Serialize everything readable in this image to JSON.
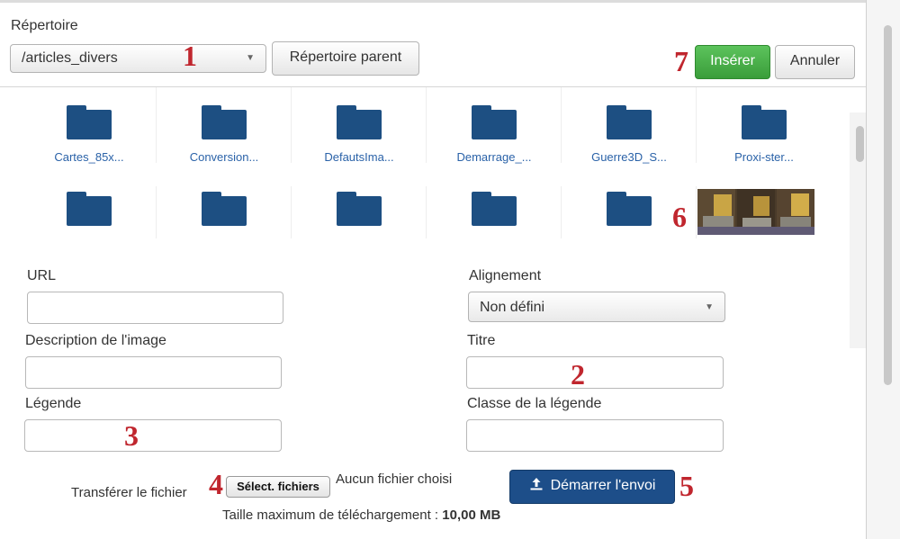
{
  "header": {
    "directory_label": "Répertoire",
    "directory_value": "/articles_divers",
    "parent_button": "Répertoire parent",
    "insert_button": "Insérer",
    "cancel_button": "Annuler"
  },
  "folders": [
    {
      "label": "Cartes_85x..."
    },
    {
      "label": "Conversion..."
    },
    {
      "label": "DefautsIma..."
    },
    {
      "label": "Demarrage_..."
    },
    {
      "label": "Guerre3D_S..."
    },
    {
      "label": "Proxi-ster..."
    }
  ],
  "form": {
    "url_label": "URL",
    "align_label": "Alignement",
    "align_value": "Non défini",
    "description_label": "Description de l'image",
    "title_label": "Titre",
    "caption_label": "Légende",
    "caption_class_label": "Classe de la légende"
  },
  "upload": {
    "transfer_label": "Transférer le fichier",
    "select_files_button": "Sélect. fichiers",
    "no_file_text": "Aucun fichier choisi",
    "start_upload_button": "Démarrer l'envoi",
    "max_size_label": "Taille maximum de téléchargement :",
    "max_size_value": "10,00 MB"
  },
  "annotations": [
    "1",
    "2",
    "3",
    "4",
    "5",
    "6",
    "7"
  ],
  "colors": {
    "accent_green": "#3fa63f",
    "folder_blue": "#1d4f82",
    "upload_blue": "#1d4e89",
    "annotation_red": "#c0262e",
    "link_blue": "#2a62a8"
  }
}
